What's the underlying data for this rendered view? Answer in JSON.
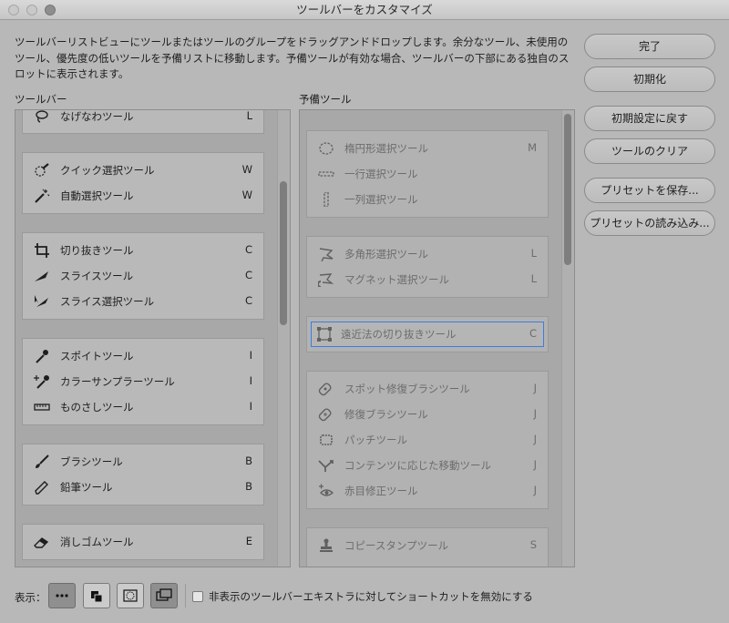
{
  "window": {
    "title": "ツールバーをカスタマイズ"
  },
  "description": "ツールバーリストビューにツールまたはツールのグループをドラッグアンドドロップします。余分なツール、未使用のツール、優先度の低いツールを予備リストに移動します。予備ツールが有効な場合、ツールバーの下部にある独自のスロットに表示されます。",
  "toolbar_section": {
    "label": "ツールバー",
    "groups": [
      {
        "tools": [
          {
            "name": "なげなわツール",
            "key": "L",
            "icon": "lasso-icon"
          }
        ]
      },
      {
        "tools": [
          {
            "name": "クイック選択ツール",
            "key": "W",
            "icon": "quick-select-icon"
          },
          {
            "name": "自動選択ツール",
            "key": "W",
            "icon": "magic-wand-icon"
          }
        ]
      },
      {
        "tools": [
          {
            "name": "切り抜きツール",
            "key": "C",
            "icon": "crop-icon"
          },
          {
            "name": "スライスツール",
            "key": "C",
            "icon": "slice-icon"
          },
          {
            "name": "スライス選択ツール",
            "key": "C",
            "icon": "slice-select-icon"
          }
        ]
      },
      {
        "tools": [
          {
            "name": "スポイトツール",
            "key": "I",
            "icon": "eyedropper-icon"
          },
          {
            "name": "カラーサンプラーツール",
            "key": "I",
            "icon": "color-sampler-icon"
          },
          {
            "name": "ものさしツール",
            "key": "I",
            "icon": "ruler-icon"
          }
        ]
      },
      {
        "tools": [
          {
            "name": "ブラシツール",
            "key": "B",
            "icon": "brush-icon"
          },
          {
            "name": "鉛筆ツール",
            "key": "B",
            "icon": "pencil-icon"
          }
        ]
      },
      {
        "tools": [
          {
            "name": "消しゴムツール",
            "key": "E",
            "icon": "eraser-icon"
          }
        ]
      }
    ]
  },
  "reserve_section": {
    "label": "予備ツール",
    "groups": [
      {
        "tools": [
          {
            "name": "楕円形選択ツール",
            "key": "M",
            "icon": "ellipse-marquee-icon"
          },
          {
            "name": "一行選択ツール",
            "key": "",
            "icon": "single-row-marquee-icon"
          },
          {
            "name": "一列選択ツール",
            "key": "",
            "icon": "single-column-marquee-icon"
          }
        ]
      },
      {
        "tools": [
          {
            "name": "多角形選択ツール",
            "key": "L",
            "icon": "polygon-lasso-icon"
          },
          {
            "name": "マグネット選択ツール",
            "key": "L",
            "icon": "magnetic-lasso-icon"
          }
        ]
      },
      {
        "tools": [
          {
            "name": "遠近法の切り抜きツール",
            "key": "C",
            "icon": "perspective-crop-icon"
          }
        ]
      },
      {
        "tools": [
          {
            "name": "スポット修復ブラシツール",
            "key": "J",
            "icon": "spot-healing-icon"
          },
          {
            "name": "修復ブラシツール",
            "key": "J",
            "icon": "healing-brush-icon"
          },
          {
            "name": "パッチツール",
            "key": "J",
            "icon": "patch-icon"
          },
          {
            "name": "コンテンツに応じた移動ツール",
            "key": "J",
            "icon": "content-aware-move-icon"
          },
          {
            "name": "赤目修正ツール",
            "key": "J",
            "icon": "red-eye-icon"
          }
        ]
      },
      {
        "tools": [
          {
            "name": "コピースタンプツール",
            "key": "S",
            "icon": "clone-stamp-icon"
          }
        ]
      }
    ]
  },
  "buttons": {
    "done": "完了",
    "reset": "初期化",
    "restore_defaults": "初期設定に戻す",
    "clear_tools": "ツールのクリア",
    "save_preset": "プリセットを保存...",
    "load_preset": "プリセットの読み込み..."
  },
  "bottom": {
    "show_label": "表示：",
    "checkbox_label": "非表示のツールバーエキストラに対してショートカットを無効にする",
    "checkbox_checked": false
  }
}
